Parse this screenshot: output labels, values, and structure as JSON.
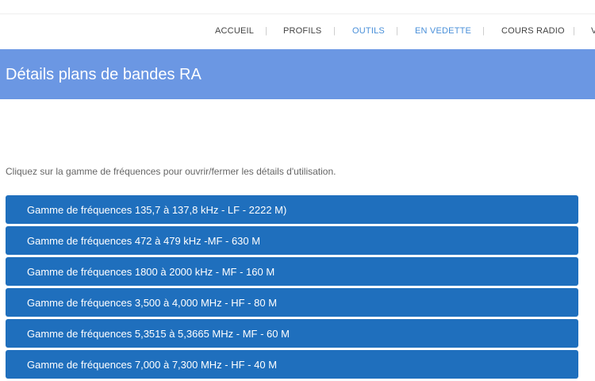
{
  "nav": {
    "items": [
      {
        "label": "ACCUEIL"
      },
      {
        "label": "PROFILS"
      },
      {
        "label": "OUTILS"
      },
      {
        "label": "EN VEDETTE"
      },
      {
        "label": "COURS RADIO"
      },
      {
        "label": "V"
      }
    ],
    "separator": "|",
    "active_color": "#4a90d9"
  },
  "banner": {
    "title": "Détails plans de bandes RA",
    "color": "#6b97e3"
  },
  "instruction": "Cliquez sur la gamme de fréquences pour ouvrir/fermer les détails d'utilisation.",
  "bands": {
    "color": "#1f6fbd",
    "items": [
      {
        "label": "Gamme de fréquences 135,7 à 137,8 kHz - LF - 2222 M)"
      },
      {
        "label": "Gamme de fréquences 472 à 479 kHz -MF - 630 M"
      },
      {
        "label": "Gamme de fréquences 1800 à 2000 kHz - MF - 160 M"
      },
      {
        "label": "Gamme de fréquences 3,500 à 4,000 MHz - HF - 80 M"
      },
      {
        "label": "Gamme de fréquences 5,3515 à 5,3665 MHz - MF - 60 M"
      },
      {
        "label": "Gamme de fréquences 7,000 à 7,300 MHz - HF - 40 M"
      }
    ]
  }
}
